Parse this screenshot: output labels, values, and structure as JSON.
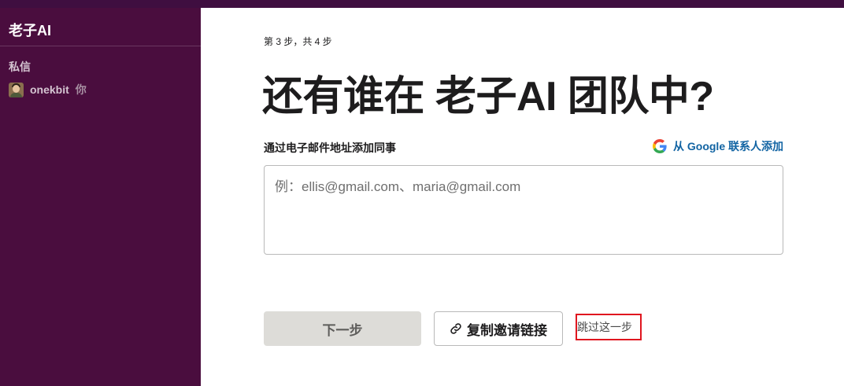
{
  "sidebar": {
    "workspace_name": "老子AI",
    "section_label": "私信",
    "dm_user": {
      "name": "onekbit",
      "you_tag": "你",
      "avatar_icon": "user-avatar"
    }
  },
  "main": {
    "step_text": "第 3 步，共 4 步",
    "heading": "还有谁在 老子AI 团队中?",
    "email_label": "通过电子邮件地址添加同事",
    "google_link": {
      "icon": "google-g-icon",
      "label": "从 Google 联系人添加"
    },
    "email_input": {
      "value": "",
      "placeholder": "例：ellis@gmail.com、maria@gmail.com"
    },
    "next_button": "下一步",
    "copy_link_button": {
      "icon": "link-icon",
      "label": "复制邀请链接"
    },
    "skip_link": "跳过这一步"
  },
  "colors": {
    "sidebar_bg": "#4a0d3e",
    "topbar_bg": "#3f0e40",
    "link_blue": "#1264a3",
    "highlight_red": "#e0161f",
    "disabled_button_bg": "#dddcd8"
  }
}
